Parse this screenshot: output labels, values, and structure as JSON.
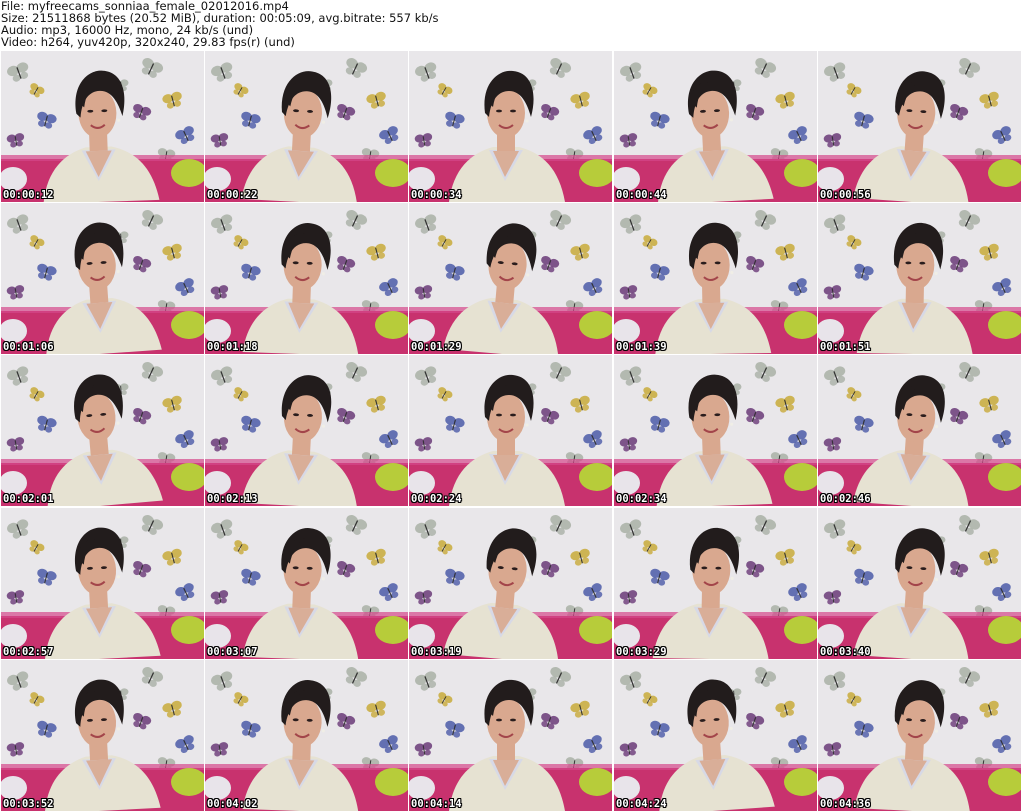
{
  "header": {
    "file_line": "File: myfreecams_sonniaa_female_02012016.mp4",
    "size_line": "Size: 21511868 bytes (20.52 MiB), duration: 00:05:09, avg.bitrate: 557 kb/s",
    "audio_line": "Audio: mp3, 16000 Hz, mono, 24 kb/s (und)",
    "video_line": "Video: h264, yuv420p, 320x240, 29.83 fps(r) (und)"
  },
  "frames": [
    {
      "timestamp": "00:00:12",
      "tilt": -2
    },
    {
      "timestamp": "00:00:22",
      "tilt": 3
    },
    {
      "timestamp": "00:00:34",
      "tilt": 0
    },
    {
      "timestamp": "00:00:44",
      "tilt": -3
    },
    {
      "timestamp": "00:00:56",
      "tilt": 4
    },
    {
      "timestamp": "00:01:06",
      "tilt": -4
    },
    {
      "timestamp": "00:01:18",
      "tilt": 2
    },
    {
      "timestamp": "00:01:29",
      "tilt": 5
    },
    {
      "timestamp": "00:01:39",
      "tilt": -1
    },
    {
      "timestamp": "00:01:51",
      "tilt": 1
    },
    {
      "timestamp": "00:02:01",
      "tilt": -5
    },
    {
      "timestamp": "00:02:13",
      "tilt": 3
    },
    {
      "timestamp": "00:02:24",
      "tilt": 0
    },
    {
      "timestamp": "00:02:34",
      "tilt": -2
    },
    {
      "timestamp": "00:02:46",
      "tilt": 4
    },
    {
      "timestamp": "00:02:57",
      "tilt": -3
    },
    {
      "timestamp": "00:03:07",
      "tilt": 2
    },
    {
      "timestamp": "00:03:19",
      "tilt": 5
    },
    {
      "timestamp": "00:03:29",
      "tilt": 1
    },
    {
      "timestamp": "00:03:40",
      "tilt": 4
    },
    {
      "timestamp": "00:03:52",
      "tilt": -3
    },
    {
      "timestamp": "00:04:02",
      "tilt": 2
    },
    {
      "timestamp": "00:04:14",
      "tilt": 0
    },
    {
      "timestamp": "00:04:24",
      "tilt": -4
    },
    {
      "timestamp": "00:04:36",
      "tilt": 3
    }
  ],
  "colors": {
    "wall": "#e9e7ea",
    "sofa": "#c8326e",
    "cardigan": "#e6e2d2",
    "hair": "#221c1c",
    "skin": "#d9a88f",
    "butterfly_1": "#6a3a78",
    "butterfly_2": "#c8aa3a",
    "butterfly_3": "#4b5aa8",
    "butterfly_4": "#a9b0a6",
    "pillow": "#b7cc3a"
  }
}
